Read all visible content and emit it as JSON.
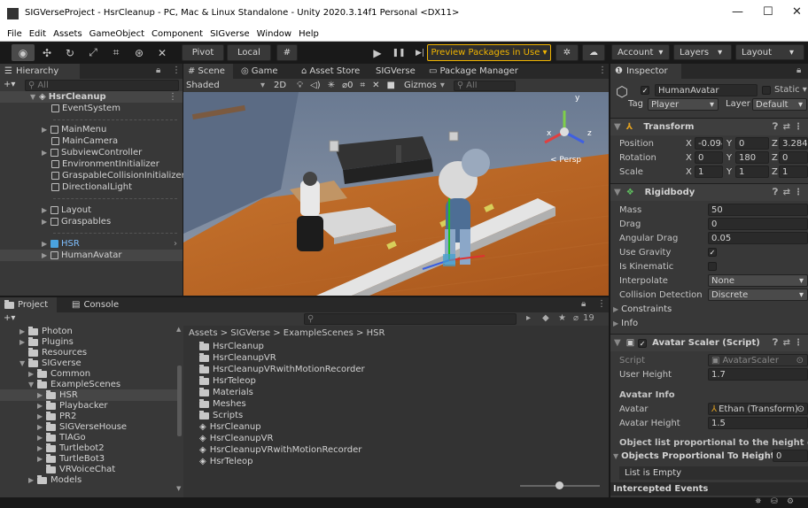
{
  "window": {
    "title": "SIGVerseProject - HsrCleanup - PC, Mac & Linux Standalone - Unity 2020.3.14f1 Personal <DX11>",
    "minimize": "—",
    "maximize": "☐",
    "close": "✕"
  },
  "menu": [
    "File",
    "Edit",
    "Assets",
    "GameObject",
    "Component",
    "SIGverse",
    "Window",
    "Help"
  ],
  "toolbar": {
    "pivot": "Pivot",
    "local": "Local",
    "play": "▶",
    "pause": "❚❚",
    "step": "▶|",
    "preview_packages": "Preview Packages in Use ▾",
    "account": "Account",
    "layers": "Layers",
    "layout": "Layout"
  },
  "hierarchy": {
    "tab": "Hierarchy",
    "search_placeholder": "All",
    "scene": "HsrCleanup",
    "items": [
      "EventSystem",
      "MainMenu",
      "MainCamera",
      "SubviewController",
      "EnvironmentInitializer",
      "GraspableCollisionInitializer",
      "DirectionalLight",
      "Layout",
      "Graspables",
      "HSR",
      "HumanAvatar"
    ]
  },
  "scene_view": {
    "tabs": [
      "Scene",
      "Game",
      "Asset Store",
      "SIGVerse",
      "Package Manager"
    ],
    "shading": "Shaded",
    "mode_2d": "2D",
    "gizmos": "Gizmos",
    "search_placeholder": "All",
    "persp": "< Persp",
    "axis_x": "x",
    "axis_y": "y",
    "axis_z": "z"
  },
  "project": {
    "tabs": [
      "Project",
      "Console"
    ],
    "breadcrumb": "Assets > SIGVerse > ExampleScenes > HSR",
    "hidden_count": "19",
    "tree": [
      "Photon",
      "Plugins",
      "Resources",
      "SIGverse",
      "Common",
      "ExampleScenes",
      "HSR",
      "Playbacker",
      "PR2",
      "SIGVerseHouse",
      "TIAGo",
      "Turtlebot2",
      "TurtleBot3",
      "VRVoiceChat",
      "Models"
    ],
    "folders": [
      "HsrCleanup",
      "HsrCleanupVR",
      "HsrCleanupVRwithMotionRecorder",
      "HsrTeleop",
      "Materials",
      "Meshes",
      "Scripts"
    ],
    "scenes": [
      "HsrCleanup",
      "HsrCleanupVR",
      "HsrCleanupVRwithMotionRecorder",
      "HsrTeleop"
    ]
  },
  "inspector": {
    "tab": "Inspector",
    "object_name": "HumanAvatar",
    "static": "Static ▾",
    "tag_label": "Tag",
    "tag": "Player",
    "layer_label": "Layer",
    "layer": "Default",
    "transform": {
      "title": "Transform",
      "position_label": "Position",
      "rotation_label": "Rotation",
      "scale_label": "Scale",
      "position": [
        "-0.094",
        "0",
        "3.284"
      ],
      "rotation": [
        "0",
        "180",
        "0"
      ],
      "scale": [
        "1",
        "1",
        "1"
      ],
      "x": "X",
      "y": "Y",
      "z": "Z"
    },
    "rigidbody": {
      "title": "Rigidbody",
      "mass_label": "Mass",
      "mass": "50",
      "drag_label": "Drag",
      "drag": "0",
      "angular_drag_label": "Angular Drag",
      "angular_drag": "0.05",
      "use_gravity_label": "Use Gravity",
      "is_kinematic_label": "Is Kinematic",
      "interpolate_label": "Interpolate",
      "interpolate": "None",
      "collision_label": "Collision Detection",
      "collision": "Discrete",
      "constraints": "Constraints",
      "info": "Info"
    },
    "avatar_scaler": {
      "title": "Avatar Scaler (Script)",
      "script_label": "Script",
      "script": "AvatarScaler",
      "user_height_label": "User Height",
      "user_height": "1.7",
      "avatar_info": "Avatar Info",
      "avatar_label": "Avatar",
      "avatar": "Ethan (Transform)",
      "avatar_height_label": "Avatar Height",
      "avatar_height": "1.5",
      "object_list_note": "Object list proportional to the height of the a",
      "objects_label": "Objects Proportional To Height",
      "objects_count": "0",
      "list_empty": "List is Empty",
      "intercepted": "Intercepted Events"
    }
  },
  "colors": {
    "accent_blue": "#2c5d87",
    "preview_orange": "#f0b400",
    "icon_blue": "#4aa3df"
  }
}
